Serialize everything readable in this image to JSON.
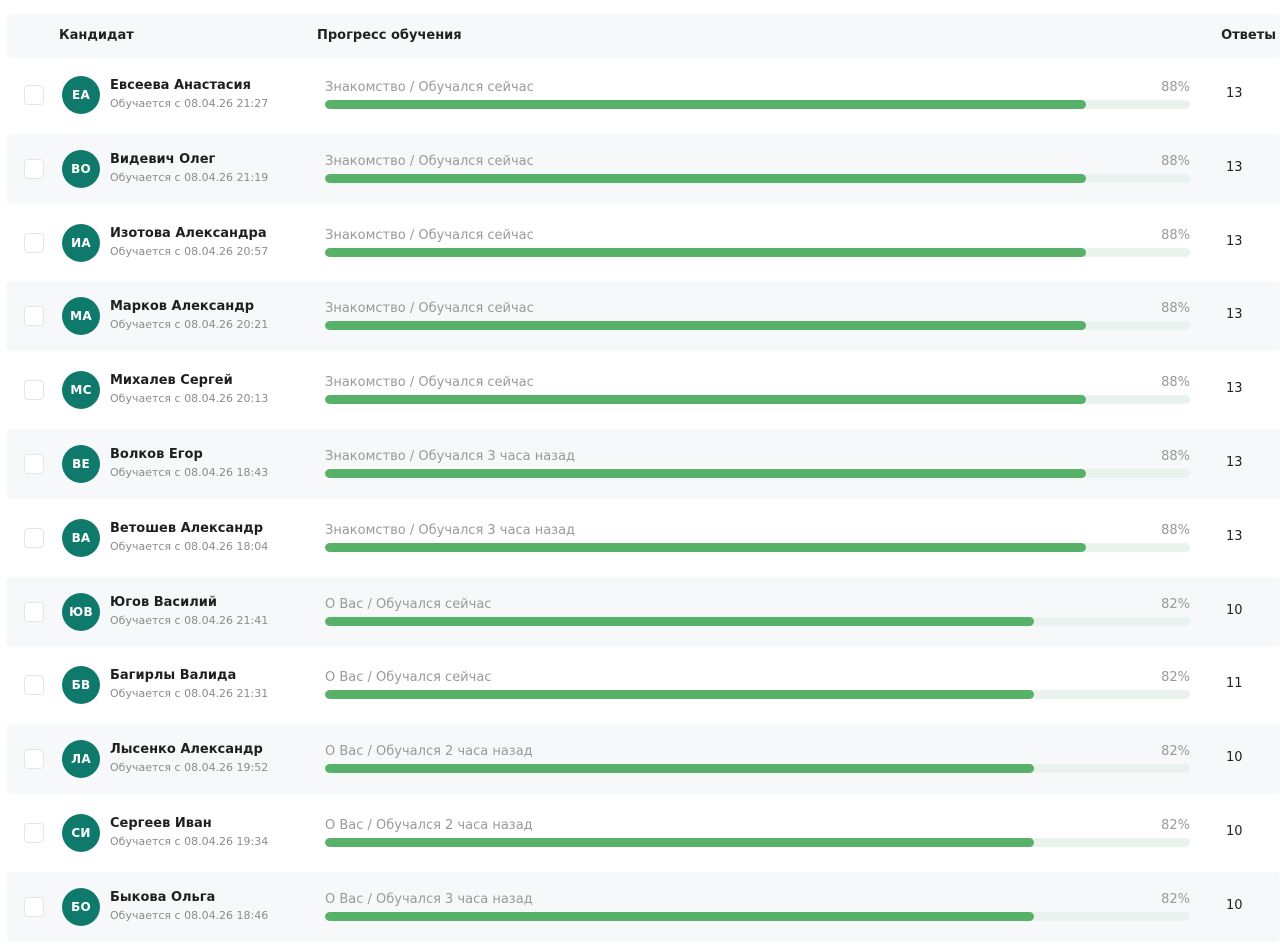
{
  "header": {
    "candidate": "Кандидат",
    "progress": "Прогресс обучения",
    "answers": "Ответы"
  },
  "colors": {
    "avatar": "#0f7a6c",
    "progress_fill": "#58b168",
    "progress_track": "#e9f2ec"
  },
  "rows": [
    {
      "initials": "ЕА",
      "name": "Евсеева Анастасия",
      "since": "Обучается с 08.04.26 21:27",
      "stage": "Знакомство / Обучался сейчас",
      "percent": "88%",
      "progress": 0.88,
      "answers": "13"
    },
    {
      "initials": "ВО",
      "name": "Видевич Олег",
      "since": "Обучается с 08.04.26 21:19",
      "stage": "Знакомство / Обучался сейчас",
      "percent": "88%",
      "progress": 0.88,
      "answers": "13"
    },
    {
      "initials": "ИА",
      "name": "Изотова Александра",
      "since": "Обучается с 08.04.26 20:57",
      "stage": "Знакомство / Обучался сейчас",
      "percent": "88%",
      "progress": 0.88,
      "answers": "13"
    },
    {
      "initials": "МА",
      "name": "Марков Александр",
      "since": "Обучается с 08.04.26 20:21",
      "stage": "Знакомство / Обучался сейчас",
      "percent": "88%",
      "progress": 0.88,
      "answers": "13"
    },
    {
      "initials": "МС",
      "name": "Михалев Сергей",
      "since": "Обучается с 08.04.26 20:13",
      "stage": "Знакомство / Обучался сейчас",
      "percent": "88%",
      "progress": 0.88,
      "answers": "13"
    },
    {
      "initials": "ВЕ",
      "name": "Волков Егор",
      "since": "Обучается с 08.04.26 18:43",
      "stage": "Знакомство / Обучался 3 часа назад",
      "percent": "88%",
      "progress": 0.88,
      "answers": "13"
    },
    {
      "initials": "ВА",
      "name": "Ветошев Александр",
      "since": "Обучается с 08.04.26 18:04",
      "stage": "Знакомство / Обучался 3 часа назад",
      "percent": "88%",
      "progress": 0.88,
      "answers": "13"
    },
    {
      "initials": "ЮВ",
      "name": "Югов Василий",
      "since": "Обучается с 08.04.26 21:41",
      "stage": "О Вас / Обучался сейчас",
      "percent": "82%",
      "progress": 0.82,
      "answers": "10"
    },
    {
      "initials": "БВ",
      "name": "Багирлы Валида",
      "since": "Обучается с 08.04.26 21:31",
      "stage": "О Вас / Обучался сейчас",
      "percent": "82%",
      "progress": 0.82,
      "answers": "11"
    },
    {
      "initials": "ЛА",
      "name": "Лысенко Александр",
      "since": "Обучается с 08.04.26 19:52",
      "stage": "О Вас / Обучался 2 часа назад",
      "percent": "82%",
      "progress": 0.82,
      "answers": "10"
    },
    {
      "initials": "СИ",
      "name": "Сергеев Иван",
      "since": "Обучается с 08.04.26 19:34",
      "stage": "О Вас / Обучался 2 часа назад",
      "percent": "82%",
      "progress": 0.82,
      "answers": "10"
    },
    {
      "initials": "БО",
      "name": "Быкова Ольга",
      "since": "Обучается с 08.04.26 18:46",
      "stage": "О Вас / Обучался 3 часа назад",
      "percent": "82%",
      "progress": 0.82,
      "answers": "10"
    }
  ]
}
